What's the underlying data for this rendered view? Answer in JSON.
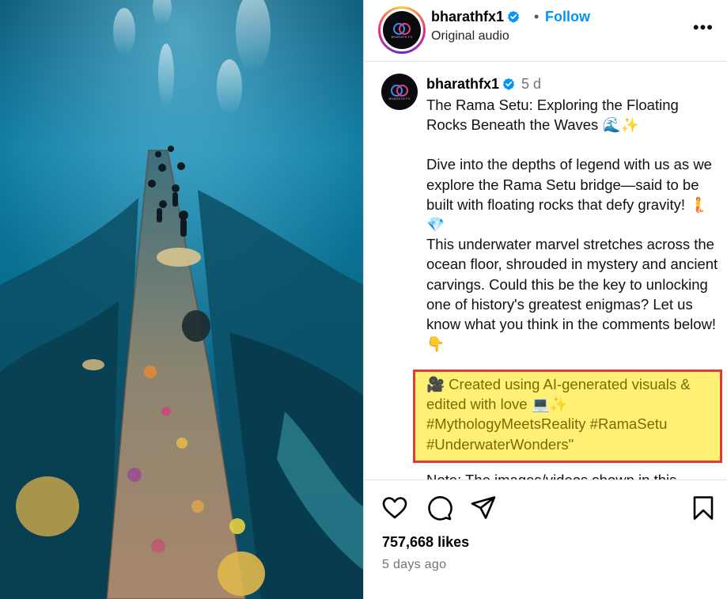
{
  "header": {
    "username": "bharathfx1",
    "separator": "•",
    "follow_label": "Follow",
    "audio": "Original audio",
    "more_icon": "more-horizontal-icon"
  },
  "avatar_logo_text": "BHARATH FX",
  "caption": {
    "username": "bharathfx1",
    "time": "5 d",
    "title": "The Rama Setu: Exploring the Floating Rocks Beneath the Waves 🌊✨",
    "para": "Dive into the depths of legend with us as we explore the Rama Setu bridge—said to be built with floating rocks that defy gravity! 🧜💎\nThis underwater marvel stretches across the ocean floor, shrouded in mystery and ancient carvings. Could this be the key to unlocking one of history's greatest enigmas? Let us know what you think in the comments below! 👇",
    "highlighted": "🎥 Created using AI-generated visuals & edited with love 💻✨\n#MythologyMeetsReality #RamaSetu #UnderwaterWonders\"",
    "cut_line": "Note: The images/videos shown in this"
  },
  "actions": {
    "like_icon": "heart-icon",
    "comment_icon": "comment-icon",
    "share_icon": "share-icon",
    "save_icon": "bookmark-icon",
    "likes": "757,668 likes",
    "posted": "5 days ago"
  },
  "colors": {
    "follow": "#0095f6",
    "highlight_fill": "#fff176",
    "highlight_border": "#e53935"
  }
}
